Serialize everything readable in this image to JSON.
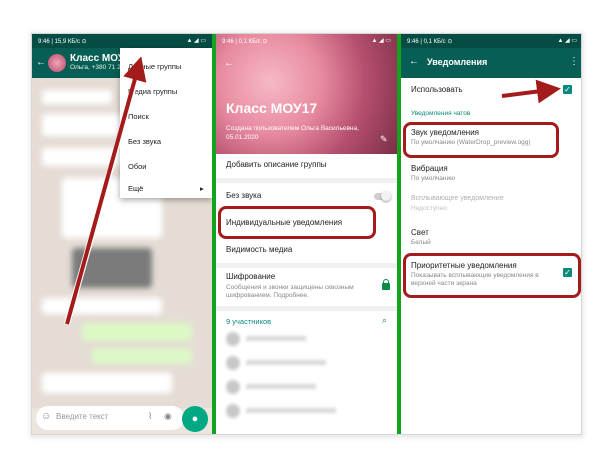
{
  "panel1": {
    "statusbar": {
      "time": "9:46 | 15,9 КБ/с ⊙",
      "icons": "▲ ◢ ▭"
    },
    "header": {
      "title": "Класс МОУ17",
      "subtitle": "Ольга, +380 71 234 ..."
    },
    "menu": {
      "items": [
        "Данные группы",
        "Медиа группы",
        "Поиск",
        "Без звука",
        "Обои",
        "Ещё"
      ],
      "more_arrow": "▸"
    },
    "input": {
      "placeholder": "Введите текст",
      "emoji_icon": "☺",
      "attach_icon": "📎",
      "camera_icon": "📷",
      "mic_icon": "🎤"
    }
  },
  "panel2": {
    "statusbar": {
      "time": "9:46 | 0,1 КБ/с ⊙",
      "icons": "▲ ◢ ▭"
    },
    "hero": {
      "title": "Класс МОУ17",
      "created": "Создана пользователем Ольга Васильевна,",
      "date": "05.01.2020"
    },
    "items": {
      "add_description": "Добавить описание группы",
      "mute": "Без звука",
      "custom_notifications": "Индивидуальные уведомления",
      "media_visibility": "Видимость медиа",
      "encryption": "Шифрование",
      "encryption_sub1": "Сообщения и звонки защищены сквозным",
      "encryption_sub2": "шифрованием. Подробнее.",
      "participants": "9 участников"
    }
  },
  "panel3": {
    "statusbar": {
      "time": "9:46 | 0,1 КБ/с ⊙",
      "icons": "▲ ◢ ▭"
    },
    "header": {
      "title": "Уведомления",
      "back": "←",
      "more": "⋮"
    },
    "use_label": "Использовать",
    "section": "Уведомления чатов",
    "sound": {
      "title": "Звук уведомления",
      "value": "По умолчанию (WaterDrop_preview.ogg)"
    },
    "vibration": {
      "title": "Вибрация",
      "value": "По умолчанию"
    },
    "popup": {
      "title": "Всплывающее уведомление",
      "value": "Недоступно"
    },
    "light": {
      "title": "Свет",
      "value": "Белый"
    },
    "priority": {
      "title": "Приоритетные уведомления",
      "value1": "Показывать всплывающие уведомления в",
      "value2": "верхней части экрана"
    },
    "checkmark": "✓"
  },
  "colors": {
    "accent": "#075e54",
    "teal": "#0a8a7a",
    "highlight": "#a31b1b",
    "divider": "#14a31e"
  }
}
